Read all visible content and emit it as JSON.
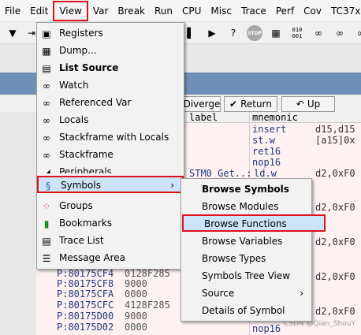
{
  "menubar": [
    "File",
    "Edit",
    "View",
    "Var",
    "Break",
    "Run",
    "CPU",
    "Misc",
    "Trace",
    "Perf",
    "Cov",
    "TC37x"
  ],
  "toolbar": {
    "stop_label": "STOP",
    "icons": [
      "arrow-down-icon",
      "step-icon",
      "bar-icon",
      "run-icon",
      "question-icon",
      "stop-icon",
      "grid-icon",
      "binary-icon",
      "glasses-icon"
    ],
    "binary_top": "010",
    "binary_bot": "001"
  },
  "list_window": {
    "buttons": {
      "diverge": "Diverge",
      "return": "Return",
      "up": "Up"
    },
    "columns": {
      "label": "label",
      "mnemonic": "mnemonic"
    },
    "code_rows": [
      {
        "mnemonic": "insert",
        "operand": "d15,d15"
      },
      {
        "mnemonic": "st.w",
        "operand": "[a15]0x"
      },
      {
        "mnemonic": "ret16",
        "operand": ""
      },
      {
        "mnemonic": "nop16",
        "operand": ""
      },
      {
        "label": "STM0_Get..:",
        "mnemonic": "ld.w",
        "operand": "d2,0xF0"
      },
      {
        "mnemonic": "",
        "operand": "d2,0xF0"
      },
      {
        "mnemonic": "",
        "operand": "d2,0xF0"
      },
      {
        "mnemonic": "",
        "operand": "d2,0xF0"
      },
      {
        "mnemonic": "",
        "operand": "d2,0xF0"
      },
      {
        "mnemonic": "nop16",
        "operand": ""
      }
    ],
    "addresses": [
      {
        "addr": "P:80175CF4",
        "hex": "0128F285"
      },
      {
        "addr": "P:80175CF8",
        "hex": "9000"
      },
      {
        "addr": "P:80175CFA",
        "hex": "0000"
      },
      {
        "addr": "P:80175CFC",
        "hex": "4128F285"
      },
      {
        "addr": "P:80175D00",
        "hex": "9000"
      },
      {
        "addr": "P:80175D02",
        "hex": "0000"
      }
    ]
  },
  "view_menu": {
    "items": [
      {
        "label": "Registers",
        "icon": "registers-icon"
      },
      {
        "label": "Dump...",
        "icon": "dump-icon"
      },
      {
        "label": "List Source",
        "icon": "list-source-icon",
        "bold": true
      },
      {
        "label": "Watch",
        "icon": "watch-icon"
      },
      {
        "label": "Referenced Var",
        "icon": "referenced-var-icon"
      },
      {
        "label": "Locals",
        "icon": "locals-icon"
      },
      {
        "label": "Stackframe with Locals",
        "icon": "stackframe-locals-icon"
      },
      {
        "label": "Stackframe",
        "icon": "stackframe-icon"
      },
      {
        "label": "Peripherals",
        "icon": "peripherals-icon"
      },
      {
        "label": "Symbols",
        "icon": "symbols-icon",
        "submenu": true,
        "highlighted": true
      },
      {
        "label": "Groups",
        "icon": "groups-icon"
      },
      {
        "label": "Bookmarks",
        "icon": "bookmark-icon"
      },
      {
        "label": "Trace List",
        "icon": "trace-list-icon"
      },
      {
        "label": "Message Area",
        "icon": "message-area-icon"
      }
    ]
  },
  "symbols_menu": {
    "items": [
      {
        "label": "Browse Symbols",
        "bold": true
      },
      {
        "label": "Browse Modules"
      },
      {
        "label": "Browse Functions",
        "highlighted": true
      },
      {
        "label": "Browse Variables"
      },
      {
        "label": "Browse Types"
      },
      {
        "label": "Symbols Tree View"
      },
      {
        "label": "Source",
        "submenu": true
      },
      {
        "label": "Details of Symbol"
      }
    ]
  },
  "watermark": "CSDN @Qian_ShouY",
  "colors": {
    "highlight": "#cce4f7",
    "annotation_red": "#e0101a",
    "titlebar": "#6f8fb8"
  }
}
